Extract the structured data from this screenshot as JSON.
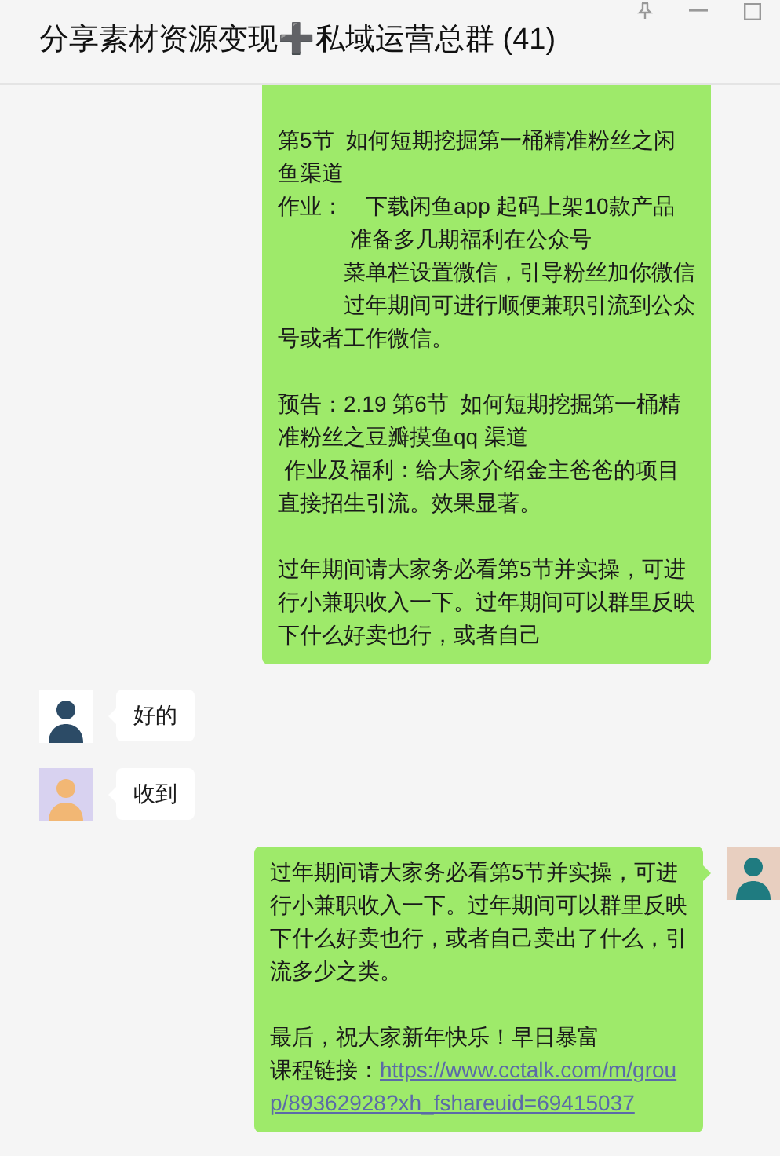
{
  "window": {
    "title": "分享素材资源变现➕私域运营总群 (41)"
  },
  "messages": [
    {
      "kind": "sent",
      "cut_top": true,
      "paragraphs": [
        [
          "第5节  如何短期挖掘第一桶精准粉丝之闲鱼渠道",
          "作业：　下载闲鱼app 起码上架10款产品",
          "　　　 准备多几期福利在公众号",
          "　　　菜单栏设置微信，引导粉丝加你微信",
          "　　　过年期间可进行顺便兼职引流到公众号或者工作微信。"
        ],
        [
          "预告：2.19 第6节  如何短期挖掘第一桶精准粉丝之豆瓣摸鱼qq 渠道",
          " 作业及福利：给大家介绍金主爸爸的项目直接招生引流。效果显著。"
        ],
        [
          "过年期间请大家务必看第5节并实操，可进行小兼职收入一下。过年期间可以群里反映下什么好卖也行，或者自己"
        ]
      ]
    },
    {
      "kind": "received",
      "cut_top": false,
      "paragraphs": [
        [
          "好的"
        ]
      ]
    },
    {
      "kind": "received",
      "cut_top": false,
      "paragraphs": [
        [
          "收到"
        ]
      ]
    },
    {
      "kind": "sent",
      "cut_top": false,
      "paragraphs": [
        [
          "过年期间请大家务必看第5节并实操，可进行小兼职收入一下。过年期间可以群里反映下什么好卖也行，或者自己卖出了什么，引流多少之类。"
        ],
        [
          "最后，祝大家新年快乐！早日暴富",
          {
            "text": "课程链接：",
            "link": "https://www.cctalk.com/m/group/89362928?xh_fshareuid=69415037"
          }
        ]
      ]
    }
  ]
}
